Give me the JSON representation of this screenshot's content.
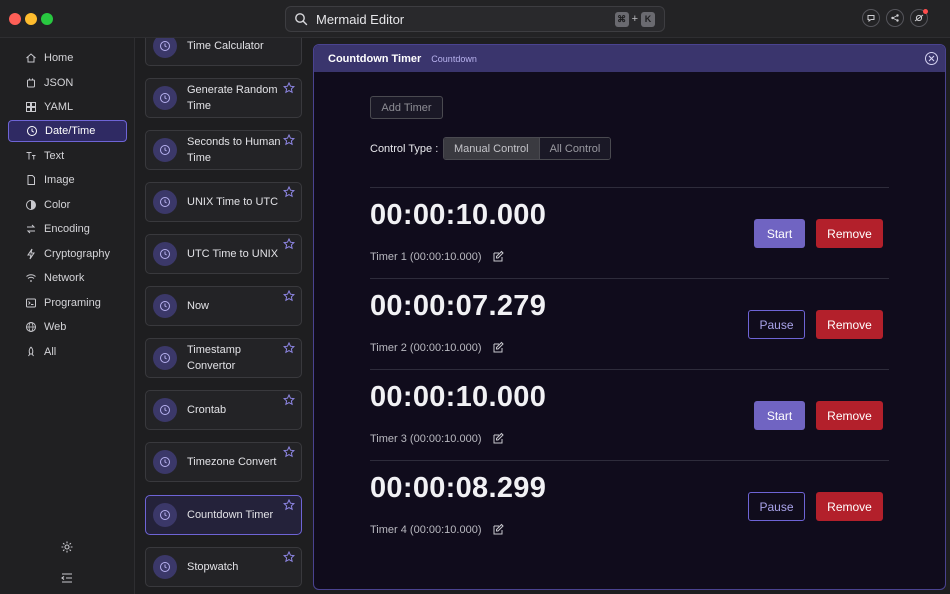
{
  "window": {
    "search_text": "Mermaid Editor",
    "shortcut": [
      "⌘",
      "+",
      "K"
    ],
    "icons": [
      "chat-icon",
      "share-icon",
      "settings-sync-icon"
    ]
  },
  "sidebar": {
    "items": [
      {
        "label": "Home",
        "icon": "home-icon"
      },
      {
        "label": "JSON",
        "icon": "json-icon"
      },
      {
        "label": "YAML",
        "icon": "yaml-icon"
      },
      {
        "label": "Date/Time",
        "icon": "clock-icon",
        "active": true
      },
      {
        "label": "Text",
        "icon": "text-icon"
      },
      {
        "label": "Image",
        "icon": "image-icon"
      },
      {
        "label": "Color",
        "icon": "color-icon"
      },
      {
        "label": "Encoding",
        "icon": "encoding-icon"
      },
      {
        "label": "Cryptography",
        "icon": "bolt-icon"
      },
      {
        "label": "Network",
        "icon": "wifi-icon"
      },
      {
        "label": "Programing",
        "icon": "terminal-icon"
      },
      {
        "label": "Web",
        "icon": "globe-icon"
      },
      {
        "label": "All",
        "icon": "rocket-icon"
      }
    ],
    "bottom_icons": [
      "gear-icon",
      "collapse-icon"
    ]
  },
  "tools": [
    {
      "label": "Time Calculator"
    },
    {
      "label": "Generate Random Time"
    },
    {
      "label": "Seconds to Human Time"
    },
    {
      "label": "UNIX Time to UTC"
    },
    {
      "label": "UTC Time to UNIX"
    },
    {
      "label": "Now"
    },
    {
      "label": "Timestamp Convertor"
    },
    {
      "label": "Crontab"
    },
    {
      "label": "Timezone Convert"
    },
    {
      "label": "Countdown Timer",
      "active": true
    },
    {
      "label": "Stopwatch"
    }
  ],
  "panel": {
    "title": "Countdown Timer",
    "subtitle": "Countdown",
    "add_timer_label": "Add Timer",
    "control_type_label": "Control Type :",
    "control_options": [
      "Manual Control",
      "All Control"
    ],
    "control_selected": "Manual Control",
    "remove_label": "Remove",
    "timers": [
      {
        "time": "00:00:10.000",
        "name": "Timer 1 (00:00:10.000)",
        "action": "Start"
      },
      {
        "time": "00:00:07.279",
        "name": "Timer 2 (00:00:10.000)",
        "action": "Pause"
      },
      {
        "time": "00:00:10.000",
        "name": "Timer 3 (00:00:10.000)",
        "action": "Start"
      },
      {
        "time": "00:00:08.299",
        "name": "Timer 4 (00:00:10.000)",
        "action": "Pause"
      }
    ]
  },
  "colors": {
    "accent": "#6e64d6",
    "danger": "#b3202b",
    "start": "#7064c2"
  }
}
